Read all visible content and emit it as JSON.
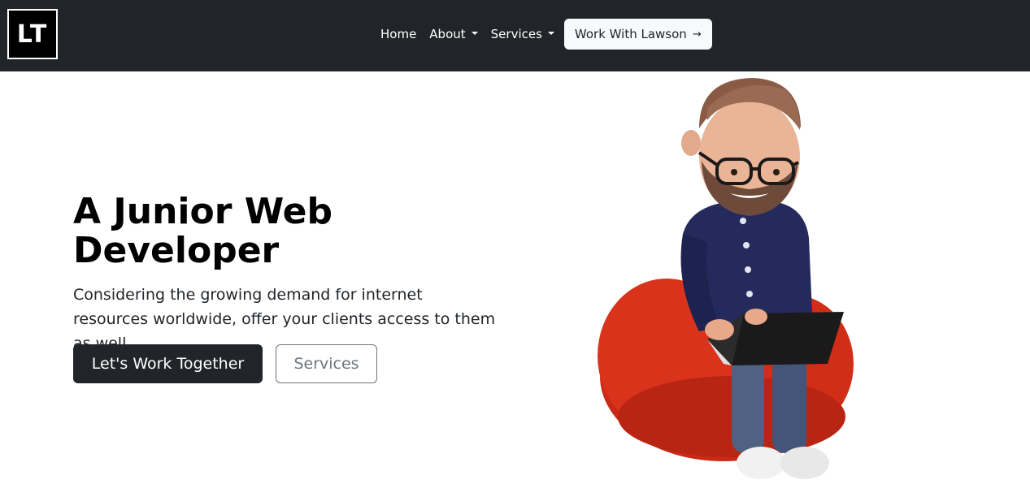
{
  "brand": {
    "logo_text": "LT"
  },
  "nav": {
    "items": [
      {
        "label": "Home",
        "dropdown": false
      },
      {
        "label": "About",
        "dropdown": true
      },
      {
        "label": "Services",
        "dropdown": true
      }
    ],
    "cta_label": "Work With Lawson",
    "cta_arrow": "→"
  },
  "hero": {
    "title": "A Junior Web Developer",
    "subtitle": "Considering the growing demand for internet resources worldwide, offer your clients access to them as well.",
    "primary_button": "Let's Work Together",
    "secondary_button": "Services"
  },
  "colors": {
    "navbar": "#212529",
    "beanbag": "#d9301a",
    "shirt": "#252a5c",
    "hair": "#8a5a45",
    "jeans": "#4f6282"
  }
}
